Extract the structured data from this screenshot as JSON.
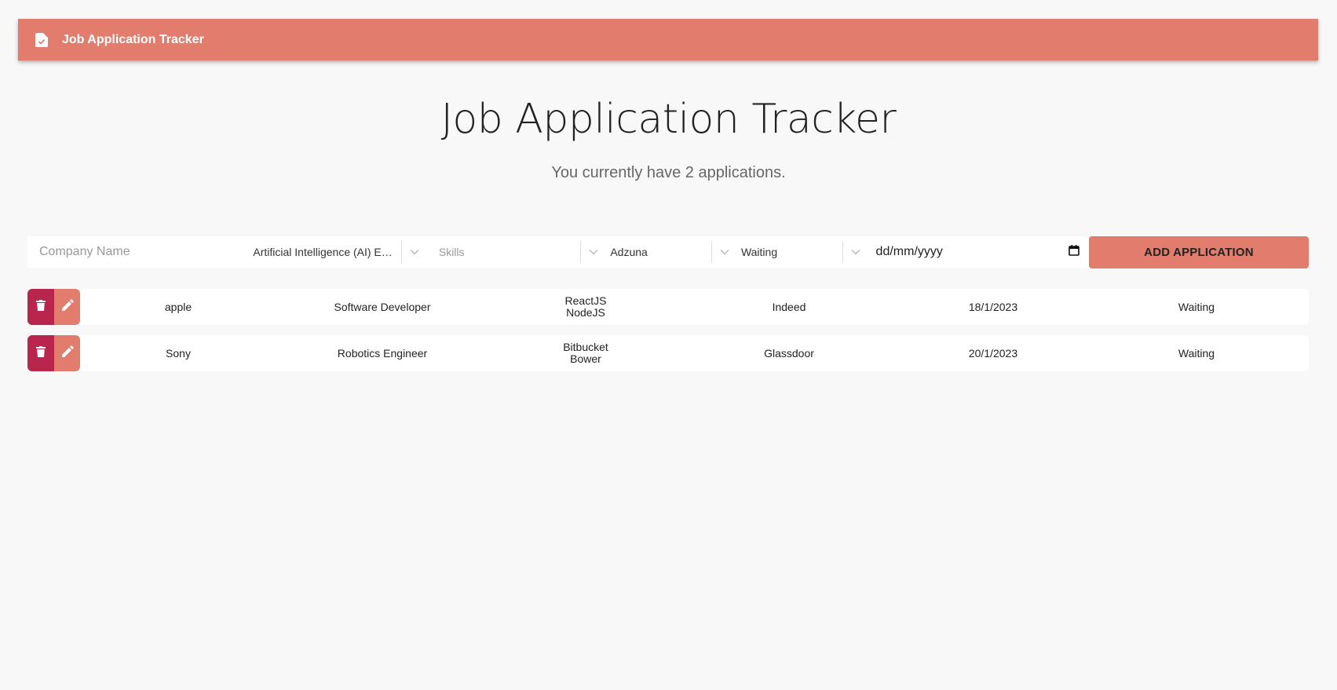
{
  "appbar": {
    "title": "Job Application Tracker",
    "icon": "file-check-icon",
    "color": "#e27d6e"
  },
  "main": {
    "heading": "Job Application Tracker",
    "subheading": "You currently have 2 applications."
  },
  "form": {
    "company_placeholder": "Company Name",
    "role_value": "Artificial Intelligence (AI) En...",
    "skills_placeholder": "Skills",
    "source_value": "Adzuna",
    "status_value": "Waiting",
    "date_value": "dd/mm/yyyy",
    "add_label": "ADD APPLICATION"
  },
  "applications": [
    {
      "company": "apple",
      "role": "Software Developer",
      "skills": [
        "ReactJS",
        "NodeJS"
      ],
      "source": "Indeed",
      "date": "18/1/2023",
      "status": "Waiting"
    },
    {
      "company": "Sony",
      "role": "Robotics Engineer",
      "skills": [
        "Bitbucket",
        "Bower"
      ],
      "source": "Glassdoor",
      "date": "20/1/2023",
      "status": "Waiting"
    }
  ],
  "colors": {
    "accent": "#e27d6e",
    "delete": "#b8264e",
    "background": "#f8f8f8"
  }
}
